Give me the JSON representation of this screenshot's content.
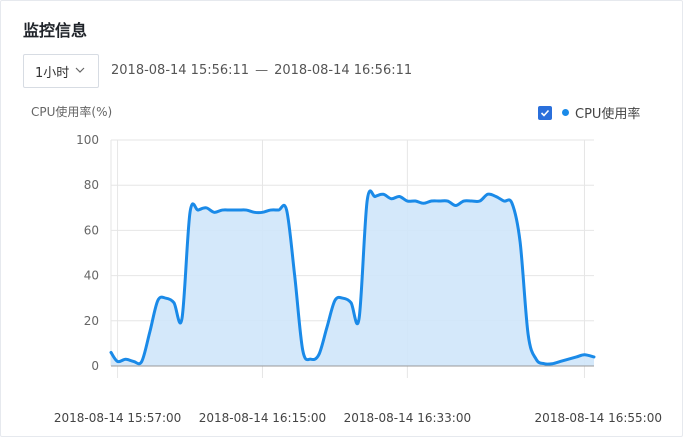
{
  "panel": {
    "title": "监控信息",
    "range_select": {
      "value": "1小时"
    },
    "time_range": {
      "start": "2018-08-14 15:56:11",
      "separator": "—",
      "end": "2018-08-14 16:56:11"
    },
    "y_axis_label": "CPU使用率(%)",
    "legend": {
      "label": "CPU使用率",
      "checked": true
    }
  },
  "colors": {
    "line": "#1a8ae8",
    "fill": "#cfe6fa",
    "checkbox": "#2a6fdb"
  },
  "chart_data": {
    "type": "area",
    "ylabel": "CPU使用率(%)",
    "ylim": [
      0,
      100
    ],
    "yticks": [
      0,
      20,
      40,
      60,
      80,
      100
    ],
    "xlim": [
      "2018-08-14 15:56:11",
      "2018-08-14 16:56:11"
    ],
    "xticks": [
      "2018-08-14 15:57:00",
      "2018-08-14 16:15:00",
      "2018-08-14 16:33:00",
      "2018-08-14 16:55:00"
    ],
    "grid": true,
    "legend_position": "top-right",
    "series": [
      {
        "name": "CPU使用率",
        "x": [
          "2018-08-14 15:56:11",
          "2018-08-14 15:57:00",
          "2018-08-14 15:58:00",
          "2018-08-14 15:59:00",
          "2018-08-14 16:00:00",
          "2018-08-14 16:01:00",
          "2018-08-14 16:02:00",
          "2018-08-14 16:03:00",
          "2018-08-14 16:04:00",
          "2018-08-14 16:05:00",
          "2018-08-14 16:06:00",
          "2018-08-14 16:07:00",
          "2018-08-14 16:08:00",
          "2018-08-14 16:09:00",
          "2018-08-14 16:10:00",
          "2018-08-14 16:11:00",
          "2018-08-14 16:12:00",
          "2018-08-14 16:13:00",
          "2018-08-14 16:14:00",
          "2018-08-14 16:15:00",
          "2018-08-14 16:16:00",
          "2018-08-14 16:17:00",
          "2018-08-14 16:18:00",
          "2018-08-14 16:19:00",
          "2018-08-14 16:20:00",
          "2018-08-14 16:21:00",
          "2018-08-14 16:22:00",
          "2018-08-14 16:23:00",
          "2018-08-14 16:24:00",
          "2018-08-14 16:25:00",
          "2018-08-14 16:26:00",
          "2018-08-14 16:27:00",
          "2018-08-14 16:28:00",
          "2018-08-14 16:29:00",
          "2018-08-14 16:30:00",
          "2018-08-14 16:31:00",
          "2018-08-14 16:32:00",
          "2018-08-14 16:33:00",
          "2018-08-14 16:34:00",
          "2018-08-14 16:35:00",
          "2018-08-14 16:36:00",
          "2018-08-14 16:37:00",
          "2018-08-14 16:38:00",
          "2018-08-14 16:39:00",
          "2018-08-14 16:40:00",
          "2018-08-14 16:41:00",
          "2018-08-14 16:42:00",
          "2018-08-14 16:43:00",
          "2018-08-14 16:44:00",
          "2018-08-14 16:45:00",
          "2018-08-14 16:46:00",
          "2018-08-14 16:47:00",
          "2018-08-14 16:48:00",
          "2018-08-14 16:49:00",
          "2018-08-14 16:50:00",
          "2018-08-14 16:51:00",
          "2018-08-14 16:52:00",
          "2018-08-14 16:53:00",
          "2018-08-14 16:54:00",
          "2018-08-14 16:55:00",
          "2018-08-14 16:56:11"
        ],
        "values": [
          6,
          2,
          3,
          2,
          2,
          15,
          29,
          30,
          28,
          21,
          68,
          69,
          70,
          68,
          69,
          69,
          69,
          69,
          68,
          68,
          69,
          69,
          69,
          40,
          7,
          3,
          5,
          17,
          29,
          30,
          28,
          21,
          73,
          75,
          76,
          74,
          75,
          73,
          73,
          72,
          73,
          73,
          73,
          71,
          73,
          73,
          73,
          76,
          75,
          73,
          72,
          55,
          14,
          3,
          1,
          1,
          2,
          3,
          4,
          5,
          4
        ]
      }
    ]
  }
}
